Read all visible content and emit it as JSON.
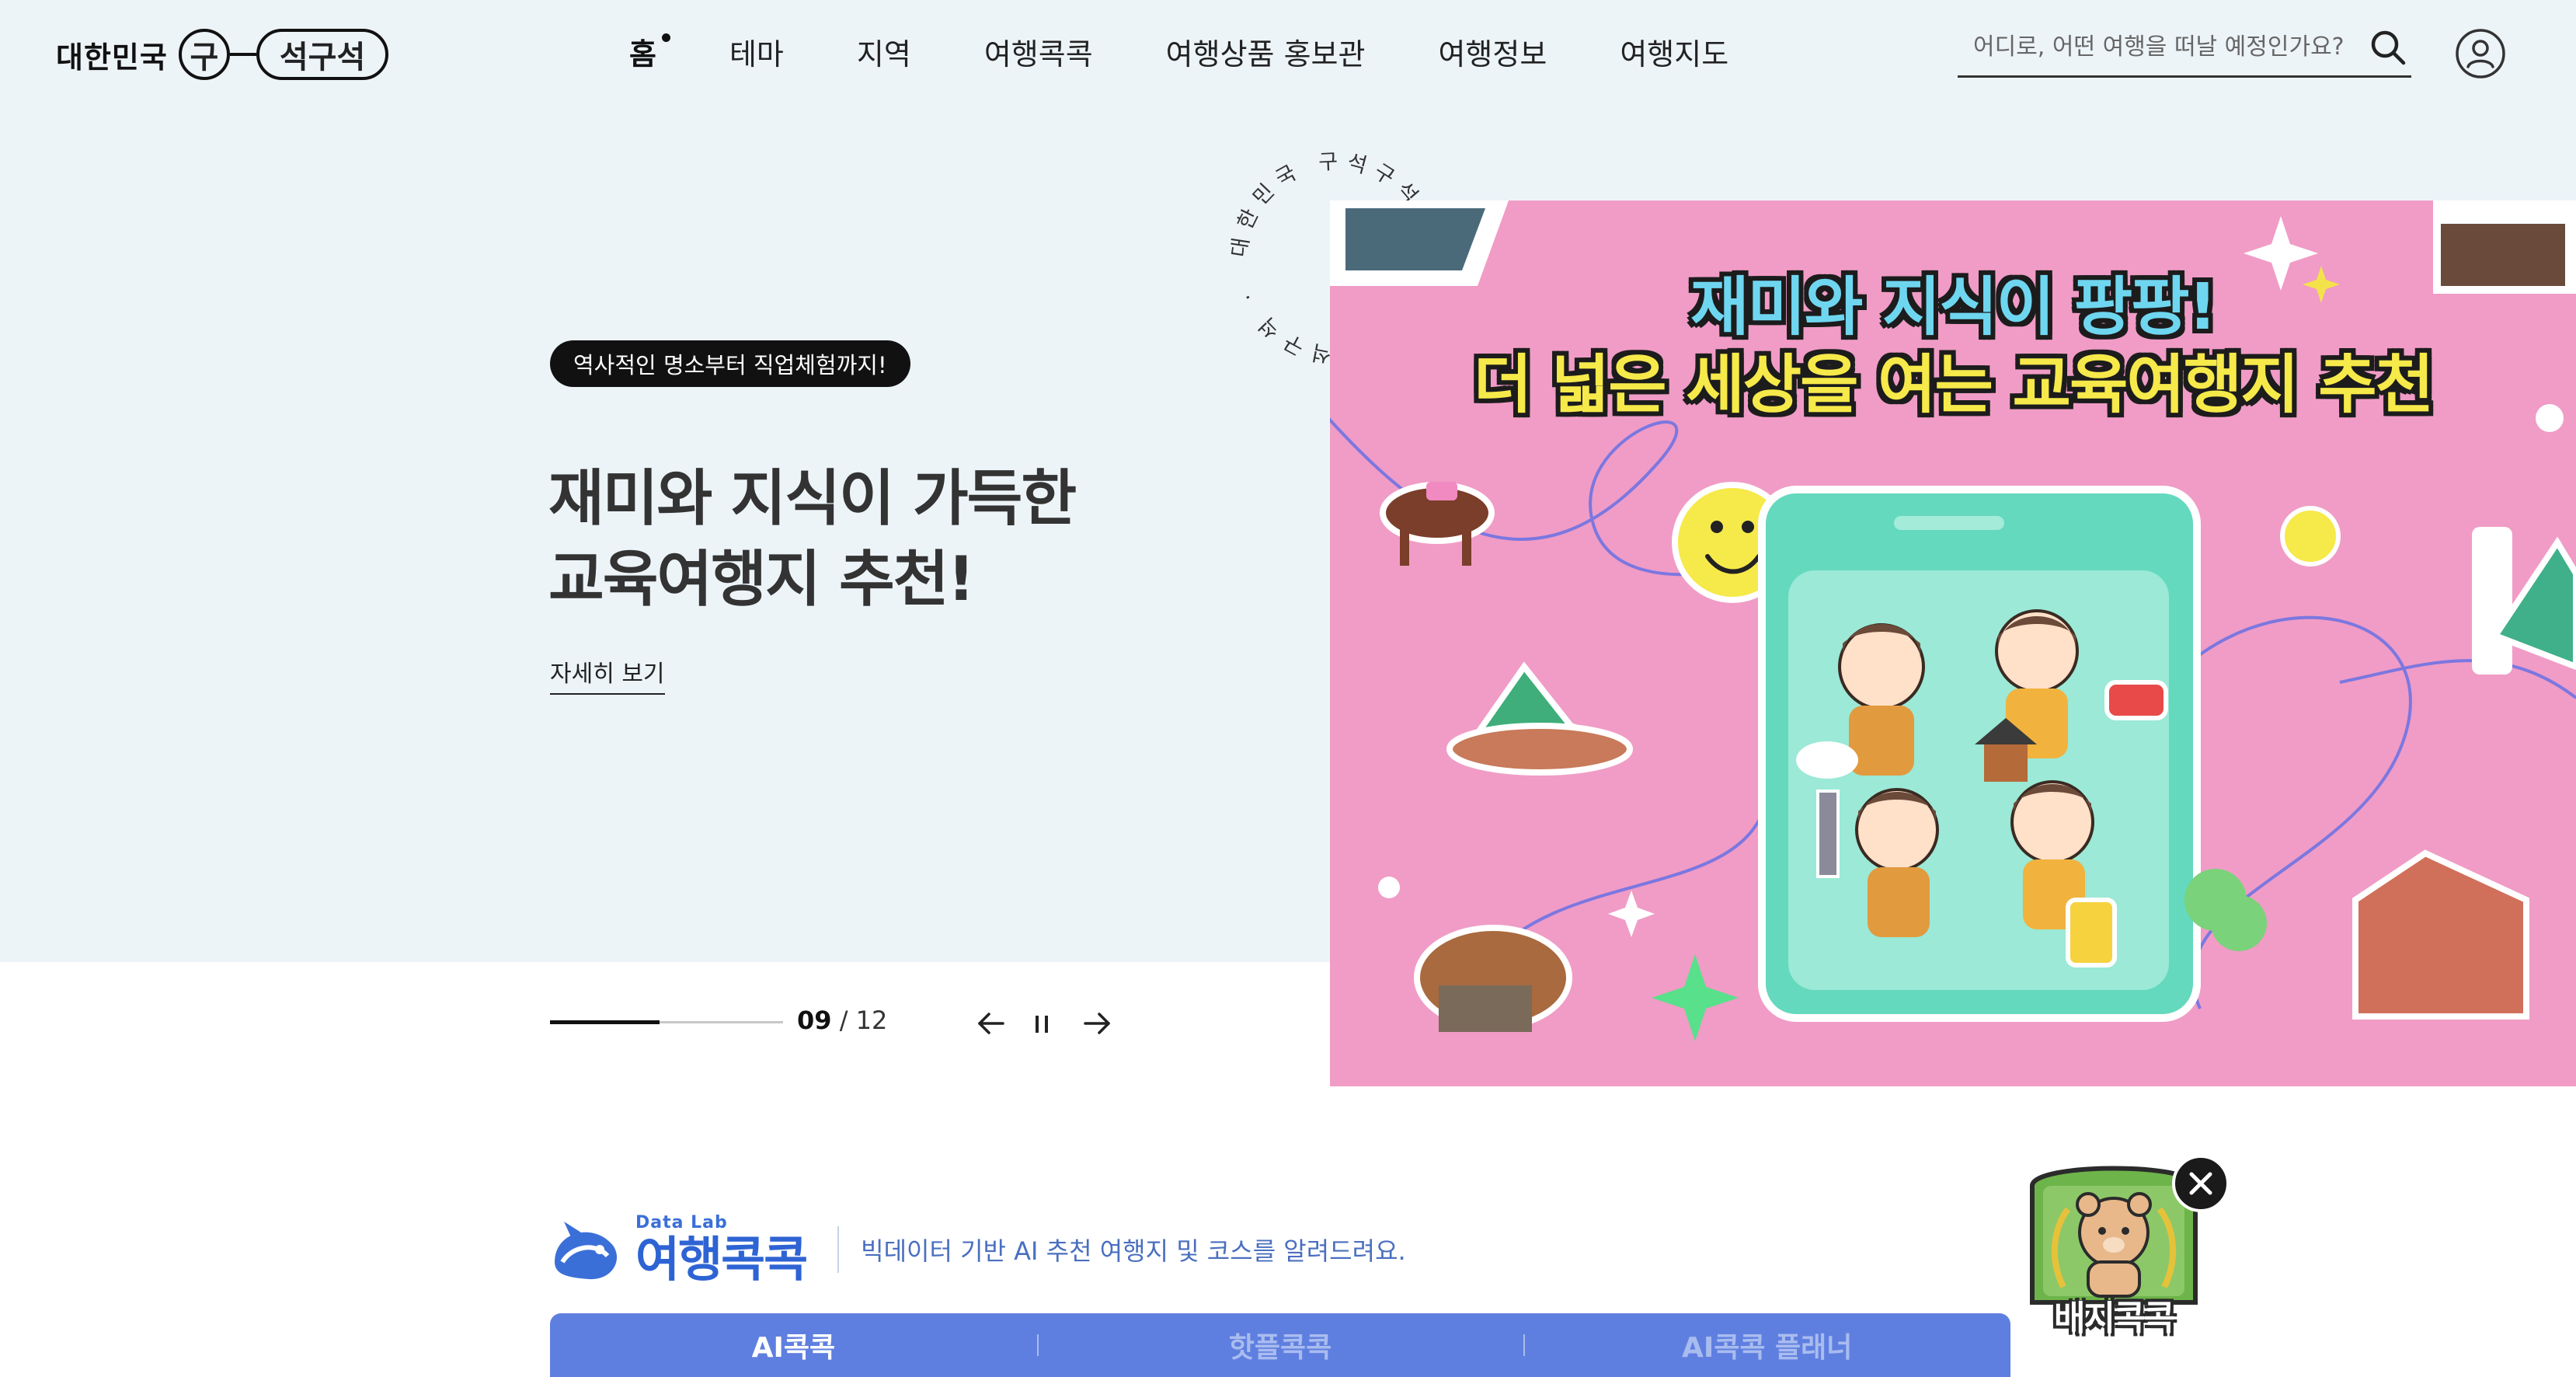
{
  "header": {
    "logo_prefix": "대한민국",
    "logo_circle": "구",
    "logo_pill": "석구석"
  },
  "nav": {
    "items": [
      "홈",
      "테마",
      "지역",
      "여행콕콕",
      "여행상품 홍보관",
      "여행정보",
      "여행지도"
    ],
    "active_index": 0
  },
  "search": {
    "placeholder": "어디로, 어떤 여행을 떠날 예정인가요?",
    "value": ""
  },
  "hero": {
    "tag": "역사적인 명소부터 직업체험까지!",
    "title_line1": "재미와 지식이 가득한",
    "title_line2": "교육여행지 추천!",
    "more_link": "자세히 보기",
    "current_slide": "09",
    "total_slides": "12",
    "counter_separator": "/",
    "progress": 0.47
  },
  "banner": {
    "headline_line1": "재미와 지식이 팡팡!",
    "headline_line2": "더 넓은 세상을 여는 교육여행지 추천",
    "circle_text": "대한민국 구석구석 · 대한민국 구석구석 · "
  },
  "datalab": {
    "small_label": "Data Lab",
    "title": "여행콕콕",
    "description": "빅데이터 기반 AI 추천 여행지 및 코스를 알려드려요."
  },
  "tabs": {
    "items": [
      "AI콕콕",
      "핫플콕콕",
      "AI콕콕 플래너"
    ],
    "active_index": 0
  },
  "badge": {
    "label": "배지콕콕"
  },
  "colors": {
    "hero_bg": "#edf4f8",
    "banner_pink": "#f09cc6",
    "tab_blue": "#5f7fe0",
    "datalab_blue": "#2e63d4"
  }
}
